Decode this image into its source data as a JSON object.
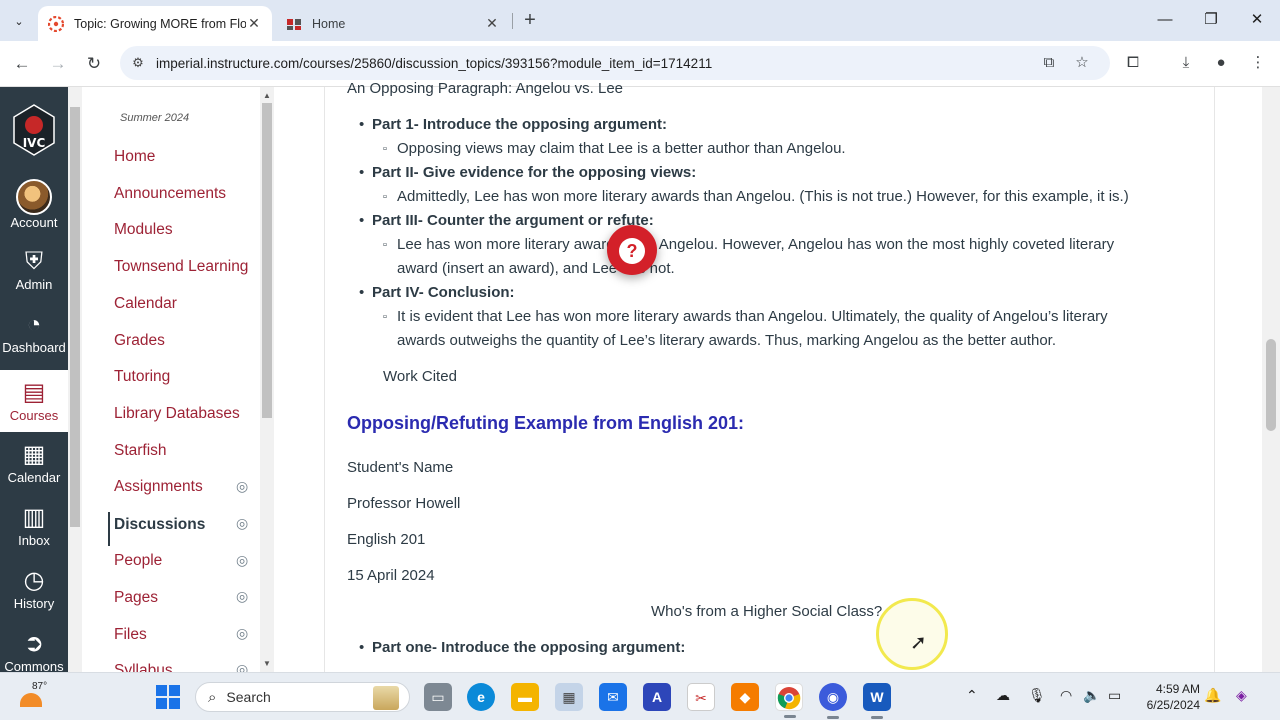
{
  "browser": {
    "tabs": [
      {
        "title": "Topic: Growing MORE from Flo",
        "active": true
      },
      {
        "title": "Home",
        "active": false
      }
    ],
    "url": "imperial.instructure.com/courses/25860/discussion_topics/393156?module_item_id=1714211"
  },
  "global_nav": {
    "items": [
      {
        "label": "Account",
        "icon": "avatar"
      },
      {
        "label": "Admin",
        "icon": "shield-icon"
      },
      {
        "label": "Dashboard",
        "icon": "dashboard-icon"
      },
      {
        "label": "Courses",
        "icon": "book-icon"
      },
      {
        "label": "Calendar",
        "icon": "calendar-icon"
      },
      {
        "label": "Inbox",
        "icon": "inbox-icon"
      },
      {
        "label": "History",
        "icon": "clock-icon"
      },
      {
        "label": "Commons",
        "icon": "commons-icon"
      }
    ],
    "active": "Courses"
  },
  "course_nav": {
    "term": "Summer 2024",
    "items": [
      {
        "label": "Home",
        "hidden": false
      },
      {
        "label": "Announcements",
        "hidden": false
      },
      {
        "label": "Modules",
        "hidden": false
      },
      {
        "label": "Townsend Learning",
        "hidden": false
      },
      {
        "label": "Calendar",
        "hidden": false
      },
      {
        "label": "Grades",
        "hidden": false
      },
      {
        "label": "Tutoring",
        "hidden": false
      },
      {
        "label": "Library Databases",
        "hidden": false
      },
      {
        "label": "Starfish",
        "hidden": false
      },
      {
        "label": "Assignments",
        "hidden": true
      },
      {
        "label": "Discussions",
        "hidden": true
      },
      {
        "label": "People",
        "hidden": true
      },
      {
        "label": "Pages",
        "hidden": true
      },
      {
        "label": "Files",
        "hidden": true
      },
      {
        "label": "Syllabus",
        "hidden": true
      }
    ],
    "current": "Discussions"
  },
  "content": {
    "top_line": "An Opposing Paragraph: Angelou vs. Lee",
    "outline": [
      {
        "part": "Part 1- Introduce the opposing argument:",
        "subs": [
          "Opposing views may claim that Lee is a better author than Angelou."
        ]
      },
      {
        "part": "Part II- Give evidence for the opposing views:",
        "subs": [
          "Admittedly, Lee has won more literary awards than Angelou. (This is not true.)  However, for this example, it is.)"
        ]
      },
      {
        "part": "Part III- Counter the argument or refute:",
        "subs": [
          "Lee has won more literary awards than Angelou. However, Angelou has won the most highly coveted literary",
          "award (insert an award), and Lee has not."
        ]
      },
      {
        "part": "Part IV- Conclusion:",
        "subs": [
          "It is evident that Lee has won more literary awards than Angelou. Ultimately, the quality of Angelou’s literary",
          "awards outweighs the quantity of Lee’s literary awards.  Thus, marking Angelou as the better author."
        ]
      }
    ],
    "works_cited": "Work Cited",
    "heading": "Opposing/Refuting Example from English 201:",
    "header_lines": [
      "Student's Name",
      "Professor Howell",
      "English 201",
      "15 April 2024"
    ],
    "essay_title": "Who's from a Higher Social Class?",
    "essay_part_one": "Part one- Introduce the opposing argument:"
  },
  "help_button": {
    "label": "?"
  },
  "taskbar": {
    "weather_temp": "87°",
    "search_placeholder": "Search",
    "time": "4:59 AM",
    "date": "6/25/2024"
  },
  "colors": {
    "canvas_nav": "#2d3b45",
    "brand_red": "#9d2235",
    "heading_blue": "#2b2bb0",
    "help_red": "#d32029"
  }
}
